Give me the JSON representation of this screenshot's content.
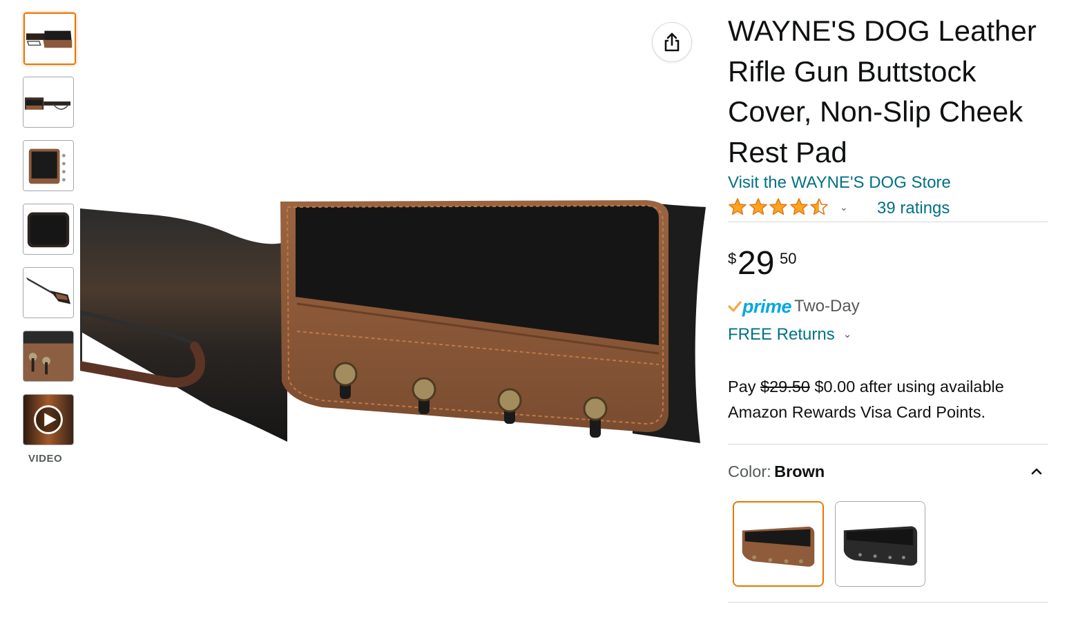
{
  "thumbnails": [
    {
      "name": "thumb-1",
      "selected": true
    },
    {
      "name": "thumb-2",
      "selected": false
    },
    {
      "name": "thumb-3",
      "selected": false
    },
    {
      "name": "thumb-4",
      "selected": false
    },
    {
      "name": "thumb-5",
      "selected": false
    },
    {
      "name": "thumb-6",
      "selected": false
    },
    {
      "name": "thumb-video",
      "selected": false
    }
  ],
  "video_label": "VIDEO",
  "product": {
    "title": "WAYNE'S DOG Leather Rifle Gun Buttstock Cover, Non-Slip Cheek Rest Pad",
    "store_link": "Visit the WAYNE'S DOG Store",
    "rating_value": 4.5,
    "rating_max": 5,
    "ratings_count": "39 ratings",
    "price": {
      "symbol": "$",
      "whole": "29",
      "fraction": "50"
    },
    "prime": {
      "logo": "prime",
      "delivery": "Two-Day"
    },
    "returns": "FREE Returns",
    "pay_offer": {
      "prefix": "Pay",
      "original": "$29.50",
      "rest": "$0.00 after using available Amazon Rewards Visa Card Points."
    },
    "color": {
      "label": "Color:",
      "value": "Brown"
    },
    "color_options": [
      {
        "name": "Brown",
        "selected": true
      },
      {
        "name": "Black",
        "selected": false
      }
    ]
  },
  "colors": {
    "link": "#007185",
    "accent_orange": "#e77600",
    "star": "#ffa41c",
    "prime_blue": "#00a8e1",
    "prime_check": "#f3a847"
  }
}
